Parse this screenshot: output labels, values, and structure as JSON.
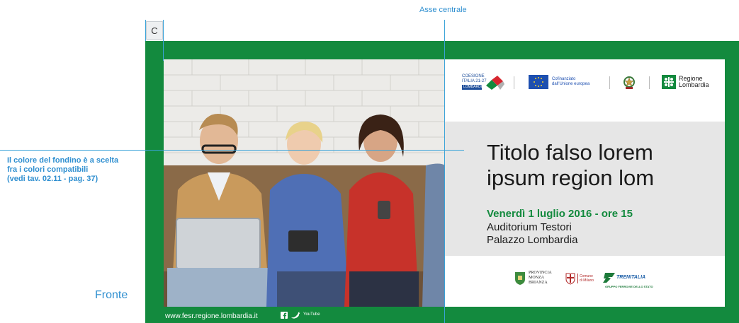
{
  "guides": {
    "axis_label": "Asse centrale",
    "corner_label": "C"
  },
  "note": {
    "lines": [
      "Il colore del fondino è a scelta",
      "fra i colori compatibili",
      "(vedi tav. 02.11 - pag. 37)"
    ]
  },
  "side_label": "Fronte",
  "colors": {
    "frame_green": "#138a3e",
    "guide_blue": "#3aa3d8",
    "band_grey": "#e6e6e6"
  },
  "header_logos": {
    "coesione": {
      "line1": "COESIONE",
      "line2": "ITALIA 21-27",
      "line3": "LOMBARDIA"
    },
    "eu": {
      "line1": "Cofinanziato",
      "line2": "dall'Unione europea"
    },
    "republic_icon": "italian-emblem-icon",
    "lombardia": {
      "line1": "Regione",
      "line2": "Lombardia"
    }
  },
  "event": {
    "title_lines": [
      "Titolo falso lorem",
      "ipsum region lom"
    ],
    "date": "Venerdì 1 luglio 2016 - ore 15",
    "venue_lines": [
      "Auditorium Testori",
      "Palazzo Lombardia"
    ]
  },
  "footer_logos": {
    "provincia": {
      "line1": "PROVINCIA",
      "line2": "MONZA",
      "line3": "BRIANZA"
    },
    "milano": {
      "line1": "Comune",
      "line2": "di Milano"
    },
    "trenitalia": {
      "name": "TRENITALIA",
      "sub": "GRUPPO FERROVIE DELLO STATO"
    }
  },
  "footer": {
    "url": "www.fesr.regione.lombardia.it",
    "social_icons": [
      "facebook-icon",
      "twitter-icon",
      "youtube-icon"
    ],
    "youtube_text": "YouTube"
  }
}
